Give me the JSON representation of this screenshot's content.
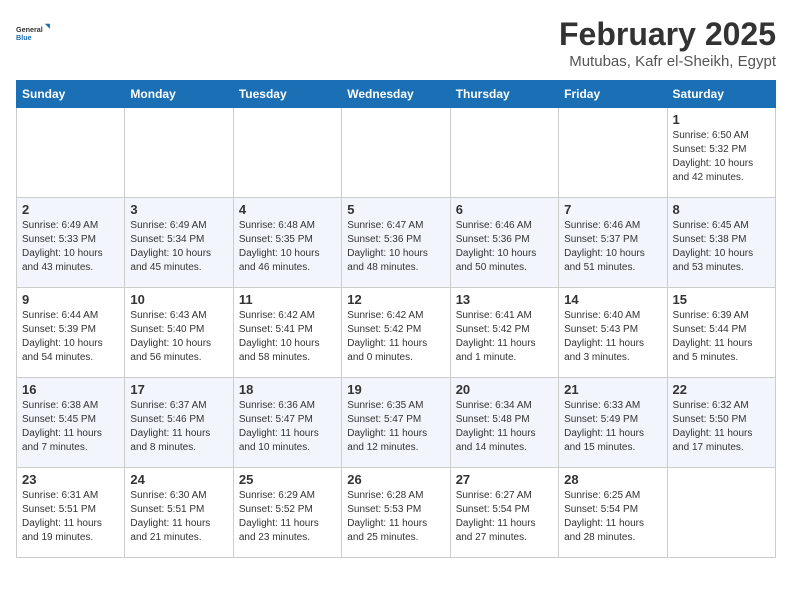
{
  "logo": {
    "text_general": "General",
    "text_blue": "Blue"
  },
  "title": "February 2025",
  "subtitle": "Mutubas, Kafr el-Sheikh, Egypt",
  "days_of_week": [
    "Sunday",
    "Monday",
    "Tuesday",
    "Wednesday",
    "Thursday",
    "Friday",
    "Saturday"
  ],
  "weeks": [
    [
      {
        "day": "",
        "info": ""
      },
      {
        "day": "",
        "info": ""
      },
      {
        "day": "",
        "info": ""
      },
      {
        "day": "",
        "info": ""
      },
      {
        "day": "",
        "info": ""
      },
      {
        "day": "",
        "info": ""
      },
      {
        "day": "1",
        "info": "Sunrise: 6:50 AM\nSunset: 5:32 PM\nDaylight: 10 hours and 42 minutes."
      }
    ],
    [
      {
        "day": "2",
        "info": "Sunrise: 6:49 AM\nSunset: 5:33 PM\nDaylight: 10 hours and 43 minutes."
      },
      {
        "day": "3",
        "info": "Sunrise: 6:49 AM\nSunset: 5:34 PM\nDaylight: 10 hours and 45 minutes."
      },
      {
        "day": "4",
        "info": "Sunrise: 6:48 AM\nSunset: 5:35 PM\nDaylight: 10 hours and 46 minutes."
      },
      {
        "day": "5",
        "info": "Sunrise: 6:47 AM\nSunset: 5:36 PM\nDaylight: 10 hours and 48 minutes."
      },
      {
        "day": "6",
        "info": "Sunrise: 6:46 AM\nSunset: 5:36 PM\nDaylight: 10 hours and 50 minutes."
      },
      {
        "day": "7",
        "info": "Sunrise: 6:46 AM\nSunset: 5:37 PM\nDaylight: 10 hours and 51 minutes."
      },
      {
        "day": "8",
        "info": "Sunrise: 6:45 AM\nSunset: 5:38 PM\nDaylight: 10 hours and 53 minutes."
      }
    ],
    [
      {
        "day": "9",
        "info": "Sunrise: 6:44 AM\nSunset: 5:39 PM\nDaylight: 10 hours and 54 minutes."
      },
      {
        "day": "10",
        "info": "Sunrise: 6:43 AM\nSunset: 5:40 PM\nDaylight: 10 hours and 56 minutes."
      },
      {
        "day": "11",
        "info": "Sunrise: 6:42 AM\nSunset: 5:41 PM\nDaylight: 10 hours and 58 minutes."
      },
      {
        "day": "12",
        "info": "Sunrise: 6:42 AM\nSunset: 5:42 PM\nDaylight: 11 hours and 0 minutes."
      },
      {
        "day": "13",
        "info": "Sunrise: 6:41 AM\nSunset: 5:42 PM\nDaylight: 11 hours and 1 minute."
      },
      {
        "day": "14",
        "info": "Sunrise: 6:40 AM\nSunset: 5:43 PM\nDaylight: 11 hours and 3 minutes."
      },
      {
        "day": "15",
        "info": "Sunrise: 6:39 AM\nSunset: 5:44 PM\nDaylight: 11 hours and 5 minutes."
      }
    ],
    [
      {
        "day": "16",
        "info": "Sunrise: 6:38 AM\nSunset: 5:45 PM\nDaylight: 11 hours and 7 minutes."
      },
      {
        "day": "17",
        "info": "Sunrise: 6:37 AM\nSunset: 5:46 PM\nDaylight: 11 hours and 8 minutes."
      },
      {
        "day": "18",
        "info": "Sunrise: 6:36 AM\nSunset: 5:47 PM\nDaylight: 11 hours and 10 minutes."
      },
      {
        "day": "19",
        "info": "Sunrise: 6:35 AM\nSunset: 5:47 PM\nDaylight: 11 hours and 12 minutes."
      },
      {
        "day": "20",
        "info": "Sunrise: 6:34 AM\nSunset: 5:48 PM\nDaylight: 11 hours and 14 minutes."
      },
      {
        "day": "21",
        "info": "Sunrise: 6:33 AM\nSunset: 5:49 PM\nDaylight: 11 hours and 15 minutes."
      },
      {
        "day": "22",
        "info": "Sunrise: 6:32 AM\nSunset: 5:50 PM\nDaylight: 11 hours and 17 minutes."
      }
    ],
    [
      {
        "day": "23",
        "info": "Sunrise: 6:31 AM\nSunset: 5:51 PM\nDaylight: 11 hours and 19 minutes."
      },
      {
        "day": "24",
        "info": "Sunrise: 6:30 AM\nSunset: 5:51 PM\nDaylight: 11 hours and 21 minutes."
      },
      {
        "day": "25",
        "info": "Sunrise: 6:29 AM\nSunset: 5:52 PM\nDaylight: 11 hours and 23 minutes."
      },
      {
        "day": "26",
        "info": "Sunrise: 6:28 AM\nSunset: 5:53 PM\nDaylight: 11 hours and 25 minutes."
      },
      {
        "day": "27",
        "info": "Sunrise: 6:27 AM\nSunset: 5:54 PM\nDaylight: 11 hours and 27 minutes."
      },
      {
        "day": "28",
        "info": "Sunrise: 6:25 AM\nSunset: 5:54 PM\nDaylight: 11 hours and 28 minutes."
      },
      {
        "day": "",
        "info": ""
      }
    ]
  ]
}
